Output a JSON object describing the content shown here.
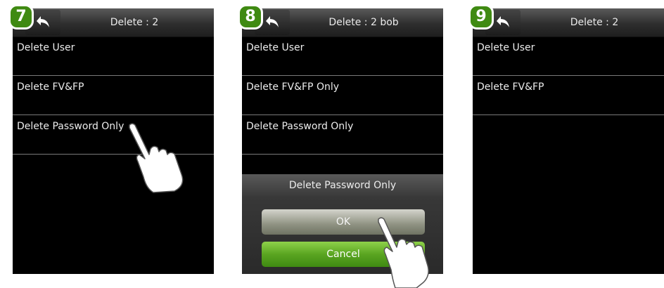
{
  "steps": [
    {
      "badge": "7",
      "title": "Delete : 2",
      "items": [
        "Delete User",
        "Delete FV&FP",
        "Delete Password Only"
      ]
    },
    {
      "badge": "8",
      "title": "Delete : 2 bob",
      "items": [
        "Delete User",
        "Delete FV&FP Only",
        "Delete Password Only"
      ],
      "dialog": {
        "title": "Delete Password Only",
        "ok_label": "OK",
        "cancel_label": "Cancel"
      }
    },
    {
      "badge": "9",
      "title": "Delete : 2",
      "items": [
        "Delete User",
        "Delete FV&FP"
      ]
    }
  ],
  "icons": {
    "back": "back-arrow-icon",
    "pointer": "hand-pointer-icon"
  },
  "colors": {
    "badge": "#3f8a12",
    "cancel_button": "#5aa521",
    "ok_button": "#9a9d8e",
    "screen": "#000000"
  }
}
